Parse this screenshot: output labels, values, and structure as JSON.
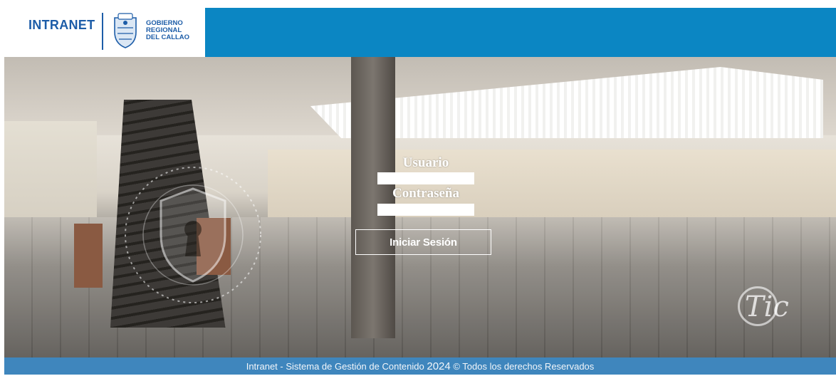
{
  "header": {
    "app_name": "INTRANET",
    "org_name_lines": [
      "GOBIERNO",
      "REGIONAL",
      "DEL CALLAO"
    ],
    "brand_color": "#0b86c3"
  },
  "login": {
    "username_label": "Usuario",
    "username_value": "",
    "password_label": "Contraseña",
    "password_value": "",
    "submit_label": "Iniciar Sesión"
  },
  "watermark": {
    "tic_logo_text": "Tic",
    "shield_icon": "shield-keyhole-icon"
  },
  "footer": {
    "text_before_year": "Intranet - Sistema de Gestión de Contenido ",
    "year": "2024",
    "text_after_year": " © Todos los derechos Reservados",
    "bg_color": "#3f86bd"
  }
}
